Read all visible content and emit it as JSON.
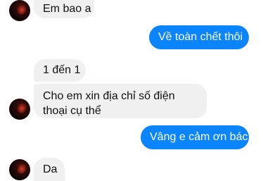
{
  "conversation": {
    "messages": [
      {
        "direction": "incoming",
        "text": "Em bao a"
      },
      {
        "direction": "outgoing",
        "text": "Về toàn chết thôi"
      },
      {
        "direction": "incoming",
        "text": "1 đến 1"
      },
      {
        "direction": "incoming",
        "text": "Cho em xin địa chỉ số điện thoại cụ thể"
      },
      {
        "direction": "outgoing",
        "text": "Vâng e cảm ơn bác"
      },
      {
        "direction": "incoming",
        "text": "Da"
      }
    ]
  },
  "colors": {
    "outgoing_bubble": "#0b84ff",
    "incoming_bubble": "#f0f0f0",
    "incoming_text": "#111111",
    "outgoing_text": "#ffffff"
  }
}
